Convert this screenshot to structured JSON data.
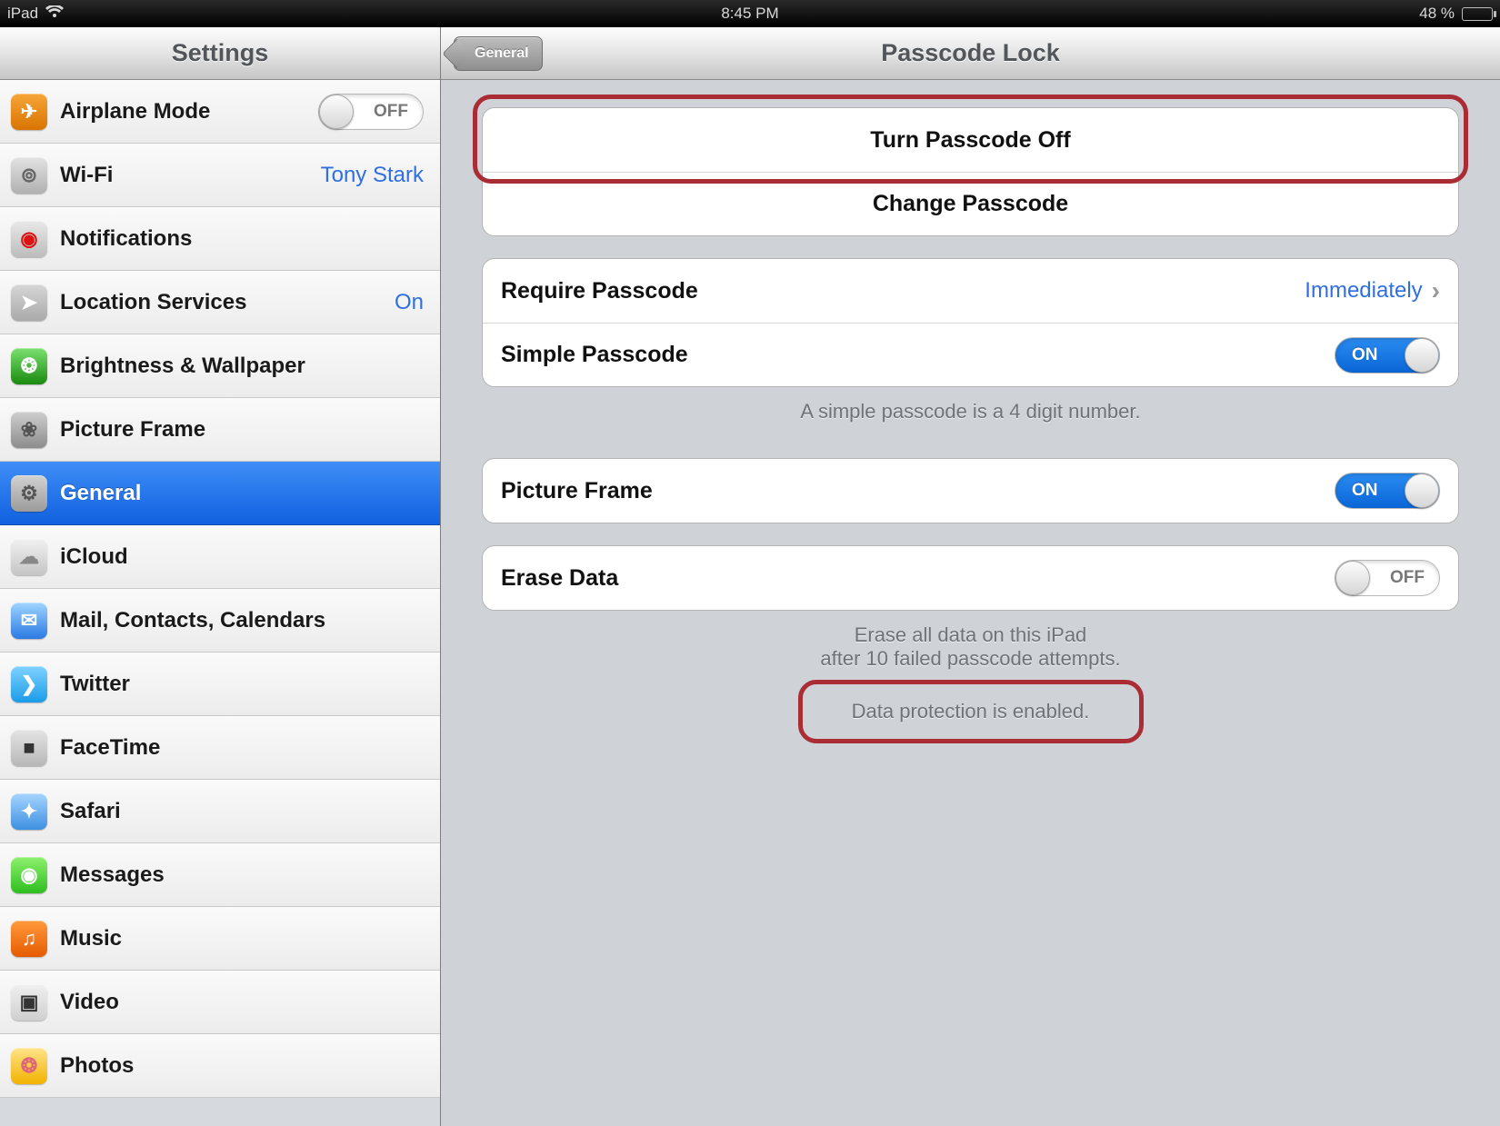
{
  "status": {
    "device": "iPad",
    "time": "8:45 PM",
    "battery_pct": "48 %",
    "battery_fill_pct": 48
  },
  "sidebar": {
    "title": "Settings",
    "items": [
      {
        "label": "Airplane Mode",
        "icon_name": "airplane-icon",
        "icon_bg": "linear-gradient(#f7a63a,#d87400)",
        "glyph": "✈",
        "glyph_color": "#fff",
        "kind": "toggle",
        "toggle": "off"
      },
      {
        "label": "Wi-Fi",
        "icon_name": "wifi-icon",
        "icon_bg": "linear-gradient(#e2e2e2,#b0b0b0)",
        "glyph": "⊚",
        "glyph_color": "#666",
        "kind": "value",
        "value": "Tony Stark"
      },
      {
        "label": "Notifications",
        "icon_name": "notifications-icon",
        "icon_bg": "linear-gradient(#e9e9e9,#bcbcbc)",
        "glyph": "◉",
        "glyph_color": "#d11",
        "kind": "nav"
      },
      {
        "label": "Location Services",
        "icon_name": "location-icon",
        "icon_bg": "linear-gradient(#d7d7d7,#a9a9a9)",
        "glyph": "➤",
        "glyph_color": "#fff",
        "kind": "value",
        "value": "On"
      },
      {
        "label": "Brightness & Wallpaper",
        "icon_name": "brightness-icon",
        "icon_bg": "linear-gradient(#7be06f,#1a8a10)",
        "glyph": "❂",
        "glyph_color": "#fff",
        "kind": "nav"
      },
      {
        "label": "Picture Frame",
        "icon_name": "picture-frame-icon",
        "icon_bg": "linear-gradient(#cfcfcf,#8c8c8c)",
        "glyph": "❀",
        "glyph_color": "#555",
        "kind": "nav"
      },
      {
        "label": "General",
        "icon_name": "general-icon",
        "icon_bg": "linear-gradient(#d2d2d2,#9b9b9b)",
        "glyph": "⚙",
        "glyph_color": "#555",
        "kind": "nav",
        "selected": true
      },
      {
        "label": "iCloud",
        "icon_name": "icloud-icon",
        "icon_bg": "linear-gradient(#f1f1f1,#c5c5c5)",
        "glyph": "☁",
        "glyph_color": "#888",
        "kind": "nav"
      },
      {
        "label": "Mail, Contacts, Calendars",
        "icon_name": "mail-icon",
        "icon_bg": "linear-gradient(#9fd5ff,#2a7ae2)",
        "glyph": "✉",
        "glyph_color": "#fff",
        "kind": "nav"
      },
      {
        "label": "Twitter",
        "icon_name": "twitter-icon",
        "icon_bg": "linear-gradient(#7fd2ff,#1a9ce8)",
        "glyph": "❯",
        "glyph_color": "#fff",
        "kind": "nav"
      },
      {
        "label": "FaceTime",
        "icon_name": "facetime-icon",
        "icon_bg": "linear-gradient(#e4e4e4,#b7b7b7)",
        "glyph": "■",
        "glyph_color": "#333",
        "kind": "nav"
      },
      {
        "label": "Safari",
        "icon_name": "safari-icon",
        "icon_bg": "linear-gradient(#a7d5ff,#3d8fe1)",
        "glyph": "✦",
        "glyph_color": "#fff",
        "kind": "nav"
      },
      {
        "label": "Messages",
        "icon_name": "messages-icon",
        "icon_bg": "linear-gradient(#8ef06e,#2ebd1f)",
        "glyph": "◉",
        "glyph_color": "#fff",
        "kind": "nav"
      },
      {
        "label": "Music",
        "icon_name": "music-icon",
        "icon_bg": "linear-gradient(#ff9a3c,#e65a00)",
        "glyph": "♫",
        "glyph_color": "#fff",
        "kind": "nav"
      },
      {
        "label": "Video",
        "icon_name": "video-icon",
        "icon_bg": "linear-gradient(#f0f0f0,#cfcfcf)",
        "glyph": "▣",
        "glyph_color": "#333",
        "kind": "nav"
      },
      {
        "label": "Photos",
        "icon_name": "photos-icon",
        "icon_bg": "linear-gradient(#ffe48a,#f2b200)",
        "glyph": "❂",
        "glyph_color": "#d67",
        "kind": "nav"
      }
    ]
  },
  "detail": {
    "title": "Passcode Lock",
    "back_label": "General",
    "actions": {
      "turn_off_label": "Turn Passcode Off",
      "change_label": "Change Passcode"
    },
    "require": {
      "label": "Require Passcode",
      "value": "Immediately"
    },
    "simple": {
      "label": "Simple Passcode",
      "toggle": "on"
    },
    "simple_desc": "A simple passcode is a 4 digit number.",
    "picture_frame": {
      "label": "Picture Frame",
      "toggle": "on"
    },
    "erase": {
      "label": "Erase Data",
      "toggle": "off"
    },
    "erase_desc_line1": "Erase all data on this iPad",
    "erase_desc_line2": "after 10 failed passcode attempts.",
    "data_protection": "Data protection is enabled."
  },
  "annotations": {
    "highlight_turn_off": true,
    "highlight_data_protection": true
  }
}
